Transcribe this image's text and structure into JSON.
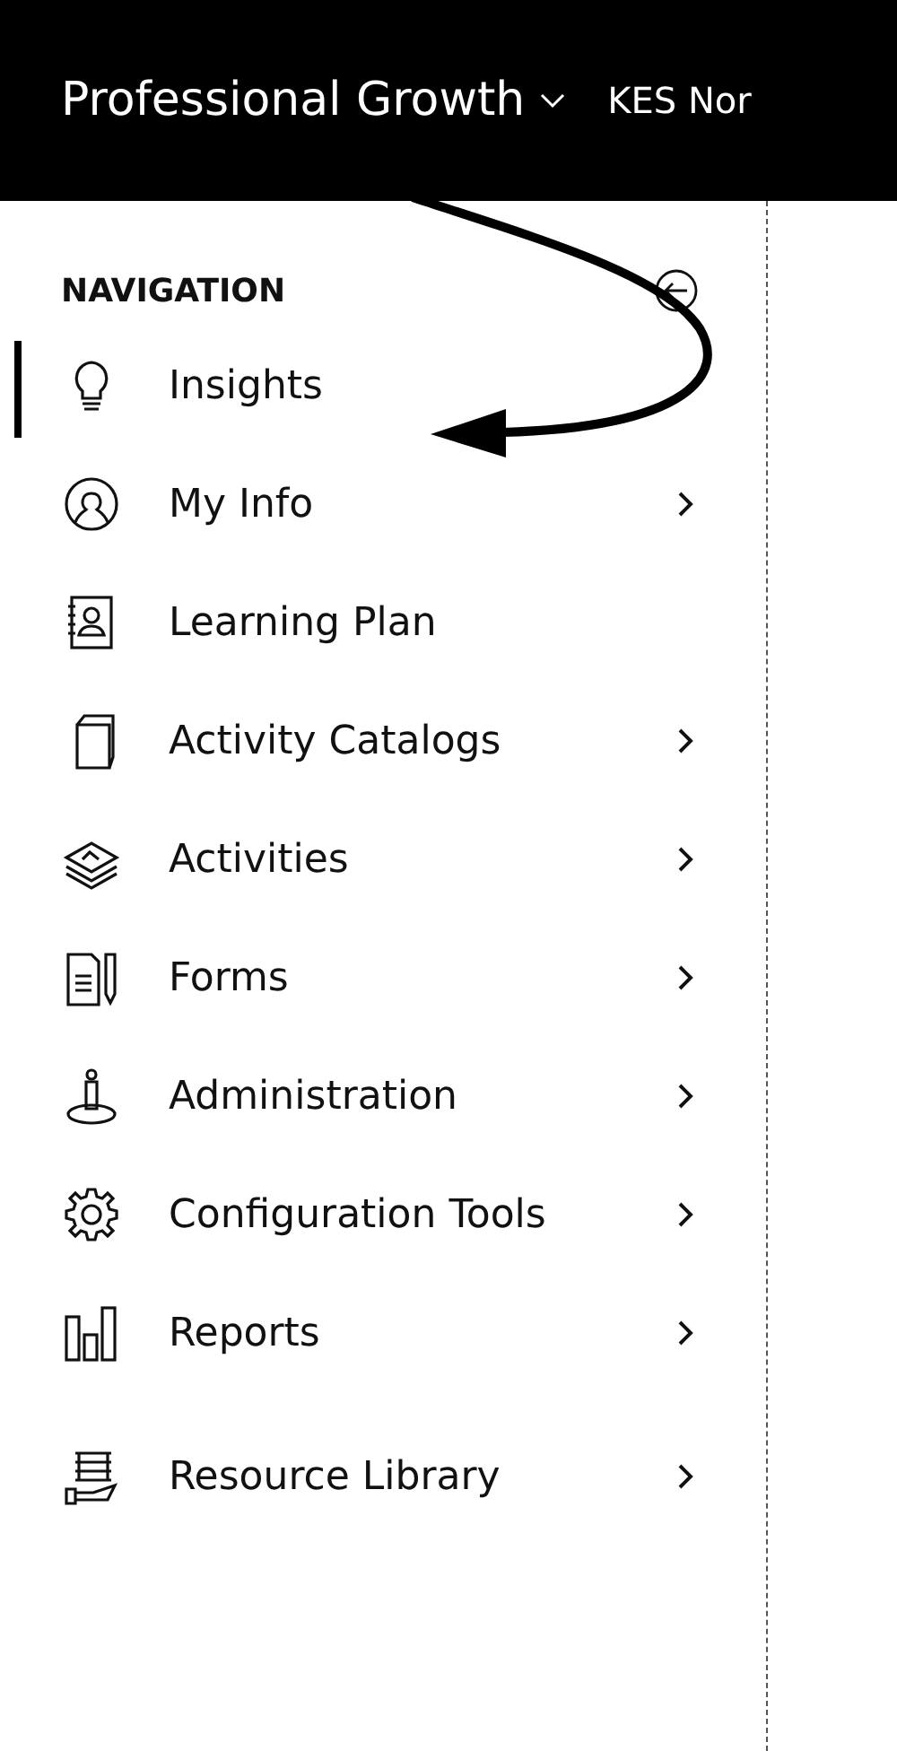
{
  "header": {
    "product": "Professional Growth",
    "organization": "KES Nor"
  },
  "navigation": {
    "title": "NAVIGATION",
    "items": [
      {
        "label": "Insights",
        "selected": true,
        "expandable": false
      },
      {
        "label": "My Info",
        "selected": false,
        "expandable": true
      },
      {
        "label": "Learning Plan",
        "selected": false,
        "expandable": false
      },
      {
        "label": "Activity Catalogs",
        "selected": false,
        "expandable": true
      },
      {
        "label": "Activities",
        "selected": false,
        "expandable": true
      },
      {
        "label": "Forms",
        "selected": false,
        "expandable": true
      },
      {
        "label": "Administration",
        "selected": false,
        "expandable": true
      },
      {
        "label": "Configuration Tools",
        "selected": false,
        "expandable": true
      },
      {
        "label": "Reports",
        "selected": false,
        "expandable": true
      },
      {
        "label": "Resource Library",
        "selected": false,
        "expandable": true
      }
    ]
  }
}
